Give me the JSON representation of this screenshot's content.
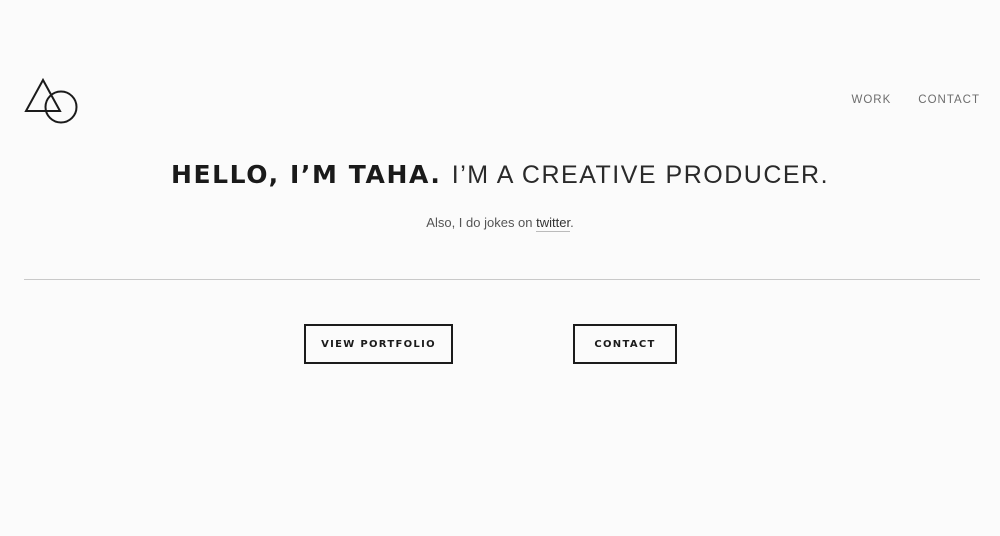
{
  "header": {
    "logo_icon": "triangle-circle-logo-icon",
    "nav": [
      {
        "label": "WORK"
      },
      {
        "label": "CONTACT"
      }
    ]
  },
  "hero": {
    "headline_bold": "HELLO, I’M TAHA.",
    "headline_light": "I’M A CREATIVE PRODUCER.",
    "subline_prefix": "Also, I do jokes on ",
    "subline_link": "twitter",
    "subline_suffix": "."
  },
  "actions": {
    "portfolio_label": "VIEW PORTFOLIO",
    "contact_label": "CONTACT"
  },
  "colors": {
    "background": "#fbfbfb",
    "text": "#1b1b1b",
    "nav": "#6d6d6d",
    "divider": "#c9c9c9"
  }
}
